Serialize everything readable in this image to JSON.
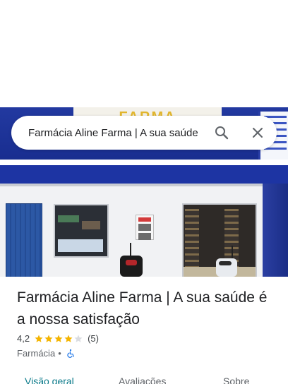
{
  "search": {
    "query": "Farmácia Aline Farma | A sua saúde"
  },
  "photo": {
    "sign_text": "FARMA"
  },
  "place": {
    "name": "Farmácia Aline Farma | A sua saúde é a nossa satisfação",
    "rating": "4,2",
    "stars_filled": 4.2,
    "stars_total": 5,
    "review_count": "(5)",
    "category": "Farmácia",
    "separator": "•",
    "accessibility_icon": "wheelchair-icon"
  },
  "tabs": [
    {
      "label": "Visão geral",
      "active": true
    },
    {
      "label": "Avaliações",
      "active": false
    },
    {
      "label": "Sobre",
      "active": false
    }
  ],
  "colors": {
    "star_filled": "#f4b400",
    "star_empty": "#dadce0",
    "accent": "#0b7a8a",
    "accessibility_blue": "#1a73e8"
  }
}
